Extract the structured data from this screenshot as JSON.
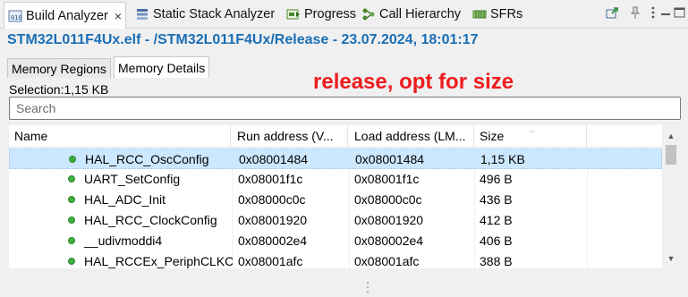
{
  "view_tabs": [
    {
      "label": "Build Analyzer",
      "icon": "build-analyzer-icon",
      "active": true
    },
    {
      "label": "Static Stack Analyzer",
      "icon": "stack-analyzer-icon"
    },
    {
      "label": "Progress",
      "icon": "progress-icon"
    },
    {
      "label": "Call Hierarchy",
      "icon": "call-hierarchy-icon"
    },
    {
      "label": "SFRs",
      "icon": "sfrs-icon"
    }
  ],
  "close_symbol": "×",
  "toolbar_icons": [
    "export-icon",
    "pin-icon",
    "view-menu-icon",
    "minimize-icon",
    "maximize-icon"
  ],
  "title": "STM32L011F4Ux.elf - /STM32L011F4Ux/Release - 23.07.2024, 18:01:17",
  "sub_tabs": [
    {
      "label": "Memory Regions"
    },
    {
      "label": "Memory Details",
      "active": true
    }
  ],
  "selection": "Selection:1,15 KB",
  "annotation": "release, opt for size",
  "search": {
    "placeholder": "Search",
    "value": ""
  },
  "table": {
    "columns": [
      "Name",
      "Run address (V...",
      "Load address (LM...",
      "Size"
    ],
    "rows": [
      {
        "name": "HAL_RCC_OscConfig",
        "run": "0x08001484",
        "load": "0x08001484",
        "size": "1,15 KB",
        "selected": true
      },
      {
        "name": "UART_SetConfig",
        "run": "0x08001f1c",
        "load": "0x08001f1c",
        "size": "496 B"
      },
      {
        "name": "HAL_ADC_Init",
        "run": "0x08000c0c",
        "load": "0x08000c0c",
        "size": "436 B"
      },
      {
        "name": "HAL_RCC_ClockConfig",
        "run": "0x08001920",
        "load": "0x08001920",
        "size": "412 B"
      },
      {
        "name": "__udivmoddi4",
        "run": "0x080002e4",
        "load": "0x080002e4",
        "size": "406 B"
      },
      {
        "name": "HAL_RCCEx_PeriphCLKConfig",
        "run": "0x08001afc",
        "load": "0x08001afc",
        "size": "388 B"
      }
    ]
  },
  "colors": {
    "title": "#1a6fb5",
    "annotation": "#ee1c1c",
    "selection": "#cce8ff",
    "symbol_dot": "#3fae3f"
  }
}
